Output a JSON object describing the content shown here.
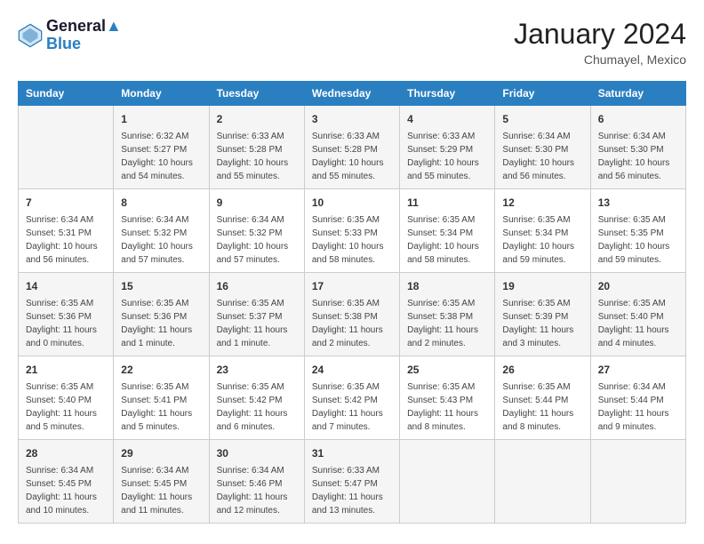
{
  "header": {
    "logo": {
      "line1": "General",
      "line2": "Blue"
    },
    "title": "January 2024",
    "location": "Chumayel, Mexico"
  },
  "days_of_week": [
    "Sunday",
    "Monday",
    "Tuesday",
    "Wednesday",
    "Thursday",
    "Friday",
    "Saturday"
  ],
  "weeks": [
    [
      {
        "day": "",
        "content": ""
      },
      {
        "day": "1",
        "content": "Sunrise: 6:32 AM\nSunset: 5:27 PM\nDaylight: 10 hours\nand 54 minutes."
      },
      {
        "day": "2",
        "content": "Sunrise: 6:33 AM\nSunset: 5:28 PM\nDaylight: 10 hours\nand 55 minutes."
      },
      {
        "day": "3",
        "content": "Sunrise: 6:33 AM\nSunset: 5:28 PM\nDaylight: 10 hours\nand 55 minutes."
      },
      {
        "day": "4",
        "content": "Sunrise: 6:33 AM\nSunset: 5:29 PM\nDaylight: 10 hours\nand 55 minutes."
      },
      {
        "day": "5",
        "content": "Sunrise: 6:34 AM\nSunset: 5:30 PM\nDaylight: 10 hours\nand 56 minutes."
      },
      {
        "day": "6",
        "content": "Sunrise: 6:34 AM\nSunset: 5:30 PM\nDaylight: 10 hours\nand 56 minutes."
      }
    ],
    [
      {
        "day": "7",
        "content": "Sunrise: 6:34 AM\nSunset: 5:31 PM\nDaylight: 10 hours\nand 56 minutes."
      },
      {
        "day": "8",
        "content": "Sunrise: 6:34 AM\nSunset: 5:32 PM\nDaylight: 10 hours\nand 57 minutes."
      },
      {
        "day": "9",
        "content": "Sunrise: 6:34 AM\nSunset: 5:32 PM\nDaylight: 10 hours\nand 57 minutes."
      },
      {
        "day": "10",
        "content": "Sunrise: 6:35 AM\nSunset: 5:33 PM\nDaylight: 10 hours\nand 58 minutes."
      },
      {
        "day": "11",
        "content": "Sunrise: 6:35 AM\nSunset: 5:34 PM\nDaylight: 10 hours\nand 58 minutes."
      },
      {
        "day": "12",
        "content": "Sunrise: 6:35 AM\nSunset: 5:34 PM\nDaylight: 10 hours\nand 59 minutes."
      },
      {
        "day": "13",
        "content": "Sunrise: 6:35 AM\nSunset: 5:35 PM\nDaylight: 10 hours\nand 59 minutes."
      }
    ],
    [
      {
        "day": "14",
        "content": "Sunrise: 6:35 AM\nSunset: 5:36 PM\nDaylight: 11 hours\nand 0 minutes."
      },
      {
        "day": "15",
        "content": "Sunrise: 6:35 AM\nSunset: 5:36 PM\nDaylight: 11 hours\nand 1 minute."
      },
      {
        "day": "16",
        "content": "Sunrise: 6:35 AM\nSunset: 5:37 PM\nDaylight: 11 hours\nand 1 minute."
      },
      {
        "day": "17",
        "content": "Sunrise: 6:35 AM\nSunset: 5:38 PM\nDaylight: 11 hours\nand 2 minutes."
      },
      {
        "day": "18",
        "content": "Sunrise: 6:35 AM\nSunset: 5:38 PM\nDaylight: 11 hours\nand 2 minutes."
      },
      {
        "day": "19",
        "content": "Sunrise: 6:35 AM\nSunset: 5:39 PM\nDaylight: 11 hours\nand 3 minutes."
      },
      {
        "day": "20",
        "content": "Sunrise: 6:35 AM\nSunset: 5:40 PM\nDaylight: 11 hours\nand 4 minutes."
      }
    ],
    [
      {
        "day": "21",
        "content": "Sunrise: 6:35 AM\nSunset: 5:40 PM\nDaylight: 11 hours\nand 5 minutes."
      },
      {
        "day": "22",
        "content": "Sunrise: 6:35 AM\nSunset: 5:41 PM\nDaylight: 11 hours\nand 5 minutes."
      },
      {
        "day": "23",
        "content": "Sunrise: 6:35 AM\nSunset: 5:42 PM\nDaylight: 11 hours\nand 6 minutes."
      },
      {
        "day": "24",
        "content": "Sunrise: 6:35 AM\nSunset: 5:42 PM\nDaylight: 11 hours\nand 7 minutes."
      },
      {
        "day": "25",
        "content": "Sunrise: 6:35 AM\nSunset: 5:43 PM\nDaylight: 11 hours\nand 8 minutes."
      },
      {
        "day": "26",
        "content": "Sunrise: 6:35 AM\nSunset: 5:44 PM\nDaylight: 11 hours\nand 8 minutes."
      },
      {
        "day": "27",
        "content": "Sunrise: 6:34 AM\nSunset: 5:44 PM\nDaylight: 11 hours\nand 9 minutes."
      }
    ],
    [
      {
        "day": "28",
        "content": "Sunrise: 6:34 AM\nSunset: 5:45 PM\nDaylight: 11 hours\nand 10 minutes."
      },
      {
        "day": "29",
        "content": "Sunrise: 6:34 AM\nSunset: 5:45 PM\nDaylight: 11 hours\nand 11 minutes."
      },
      {
        "day": "30",
        "content": "Sunrise: 6:34 AM\nSunset: 5:46 PM\nDaylight: 11 hours\nand 12 minutes."
      },
      {
        "day": "31",
        "content": "Sunrise: 6:33 AM\nSunset: 5:47 PM\nDaylight: 11 hours\nand 13 minutes."
      },
      {
        "day": "",
        "content": ""
      },
      {
        "day": "",
        "content": ""
      },
      {
        "day": "",
        "content": ""
      }
    ]
  ]
}
